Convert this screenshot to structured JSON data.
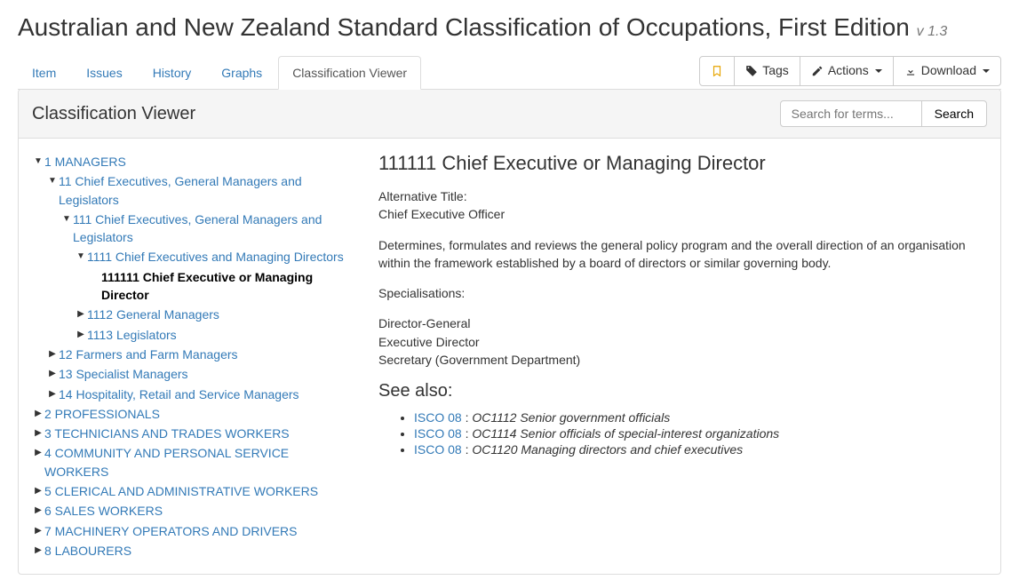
{
  "header": {
    "title": "Australian and New Zealand Standard Classification of Occupations, First Edition",
    "version_prefix": "v",
    "version": "1.3"
  },
  "tabs": [
    {
      "label": "Item",
      "active": false
    },
    {
      "label": "Issues",
      "active": false
    },
    {
      "label": "History",
      "active": false
    },
    {
      "label": "Graphs",
      "active": false
    },
    {
      "label": "Classification Viewer",
      "active": true
    }
  ],
  "toolbar": {
    "tags_label": "Tags",
    "actions_label": "Actions",
    "download_label": "Download"
  },
  "panel": {
    "heading": "Classification Viewer",
    "search_placeholder": "Search for terms...",
    "search_button": "Search"
  },
  "tree": [
    {
      "label": "1 MANAGERS",
      "expanded": true,
      "children": [
        {
          "label": "11 Chief Executives, General Managers and Legislators",
          "expanded": true,
          "children": [
            {
              "label": "111 Chief Executives, General Managers and Legislators",
              "expanded": true,
              "children": [
                {
                  "label": "1111 Chief Executives and Managing Directors",
                  "expanded": true,
                  "children": [
                    {
                      "label": "111111 Chief Executive or Managing Director",
                      "selected": true,
                      "leaf": true
                    }
                  ]
                },
                {
                  "label": "1112 General Managers",
                  "expanded": false
                },
                {
                  "label": "1113 Legislators",
                  "expanded": false
                }
              ]
            }
          ]
        },
        {
          "label": "12 Farmers and Farm Managers",
          "expanded": false
        },
        {
          "label": "13 Specialist Managers",
          "expanded": false
        },
        {
          "label": "14 Hospitality, Retail and Service Managers",
          "expanded": false
        }
      ]
    },
    {
      "label": "2 PROFESSIONALS",
      "expanded": false
    },
    {
      "label": "3 TECHNICIANS AND TRADES WORKERS",
      "expanded": false
    },
    {
      "label": "4 COMMUNITY AND PERSONAL SERVICE WORKERS",
      "expanded": false
    },
    {
      "label": "5 CLERICAL AND ADMINISTRATIVE WORKERS",
      "expanded": false
    },
    {
      "label": "6 SALES WORKERS",
      "expanded": false
    },
    {
      "label": "7 MACHINERY OPERATORS AND DRIVERS",
      "expanded": false
    },
    {
      "label": "8 LABOURERS",
      "expanded": false
    }
  ],
  "detail": {
    "title": "111111 Chief Executive or Managing Director",
    "alt_title_label": "Alternative Title:",
    "alt_title_value": "Chief Executive Officer",
    "description": "Determines, formulates and reviews the general policy program and the overall direction of an organisation within the framework established by a board of directors or similar governing body.",
    "spec_label": "Specialisations:",
    "specialisations": [
      "Director-General",
      "Executive Director",
      "Secretary (Government Department)"
    ],
    "see_also_heading": "See also:",
    "see_also": [
      {
        "link": "ISCO 08",
        "sep": " : ",
        "text": "OC1112 Senior government officials"
      },
      {
        "link": "ISCO 08",
        "sep": " : ",
        "text": "OC1114 Senior officials of special-interest organizations"
      },
      {
        "link": "ISCO 08",
        "sep": " : ",
        "text": "OC1120 Managing directors and chief executives"
      }
    ]
  }
}
